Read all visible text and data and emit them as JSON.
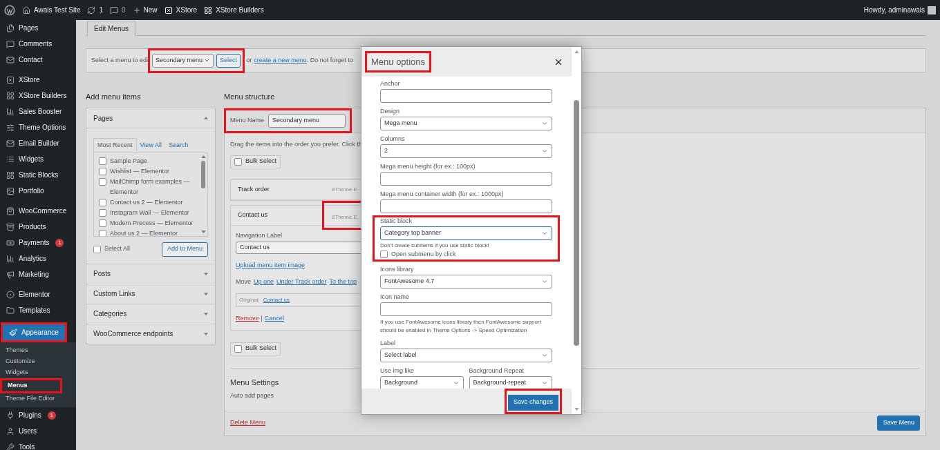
{
  "admin_bar": {
    "site": "Awais Test Site",
    "updates": "1",
    "comments": "0",
    "new": "New",
    "links": [
      "XStore",
      "XStore Builders"
    ],
    "greeting": "Howdy, adminawais"
  },
  "sidebar": {
    "groups": [
      [
        {
          "label": "Pages",
          "selected": false,
          "highlighted": false
        },
        {
          "label": "Comments",
          "selected": false,
          "highlighted": false
        },
        {
          "label": "Contact",
          "selected": false,
          "highlighted": false
        }
      ],
      [
        {
          "label": "XStore",
          "selected": false,
          "highlighted": false
        },
        {
          "label": "XStore Builders",
          "selected": false,
          "highlighted": false
        },
        {
          "label": "Sales Booster",
          "selected": false,
          "highlighted": false
        },
        {
          "label": "Theme Options",
          "selected": false,
          "highlighted": false
        },
        {
          "label": "Email Builder",
          "selected": false,
          "highlighted": false
        },
        {
          "label": "Widgets",
          "selected": false,
          "highlighted": false
        },
        {
          "label": "Static Blocks",
          "selected": false,
          "highlighted": false
        },
        {
          "label": "Portfolio",
          "selected": false,
          "highlighted": false
        }
      ],
      [
        {
          "label": "WooCommerce",
          "selected": false,
          "highlighted": false
        },
        {
          "label": "Products",
          "selected": false,
          "highlighted": false
        },
        {
          "label": "Payments",
          "badge": "1",
          "selected": false,
          "highlighted": false
        },
        {
          "label": "Analytics",
          "selected": false,
          "highlighted": false
        },
        {
          "label": "Marketing",
          "selected": false,
          "highlighted": false
        }
      ],
      [
        {
          "label": "Elementor",
          "selected": false,
          "highlighted": false
        },
        {
          "label": "Templates",
          "selected": false,
          "highlighted": false
        }
      ],
      [
        {
          "label": "Appearance",
          "selected": true,
          "highlighted": true,
          "children": [
            {
              "label": "Themes",
              "selected": false,
              "highlighted": false
            },
            {
              "label": "Customize",
              "selected": false,
              "highlighted": false
            },
            {
              "label": "Widgets",
              "selected": false,
              "highlighted": false
            },
            {
              "label": "Menus",
              "selected": true,
              "highlighted": true
            },
            {
              "label": "Theme File Editor",
              "selected": false,
              "highlighted": false
            }
          ]
        },
        {
          "label": "Plugins",
          "badge": "1",
          "selected": false,
          "highlighted": false
        },
        {
          "label": "Users",
          "selected": false,
          "highlighted": false
        },
        {
          "label": "Tools",
          "selected": false,
          "highlighted": false
        }
      ]
    ]
  },
  "tabs": [
    {
      "label": "Edit Menus",
      "selected": true
    }
  ],
  "menu_select": {
    "label": "Select a menu to edi",
    "value": "Secondary menu",
    "button": "Select",
    "highlighted": true,
    "text_before": "or",
    "link": "create a new menu",
    "text_after": ". Do not forget to"
  },
  "add_items": {
    "title": "Add menu items",
    "sections": [
      {
        "title": "Pages",
        "expanded": true,
        "tabs": [
          {
            "label": "Most Recent",
            "selected": true
          },
          {
            "label": "View All",
            "selected": false
          },
          {
            "label": "Search",
            "selected": false
          }
        ],
        "items": [
          {
            "label": "Sample Page",
            "checked": false
          },
          {
            "label": "Wishlist — Elementor",
            "checked": false
          },
          {
            "label": "MailChimp form examples — Elementor",
            "checked": false
          },
          {
            "label": "Contact us 2 — Elementor",
            "checked": false
          },
          {
            "label": "Instagram Wall — Elementor",
            "checked": false
          },
          {
            "label": "Modern Precess — Elementor",
            "checked": false
          },
          {
            "label": "About us 2 — Elementor",
            "checked": false
          }
        ],
        "select_all": {
          "label": "Select All",
          "checked": false
        },
        "button": "Add to Menu"
      },
      {
        "title": "Posts",
        "expanded": false
      },
      {
        "title": "Custom Links",
        "expanded": false
      },
      {
        "title": "Categories",
        "expanded": false
      },
      {
        "title": "WooCommerce endpoints",
        "expanded": false
      }
    ]
  },
  "structure": {
    "title": "Menu structure",
    "name_label": "Menu Name",
    "name_value": "Secondary menu",
    "name_highlighted": true,
    "hint": "Drag the items into the order you prefer. Click th",
    "bulk_select": {
      "label": "Bulk Select",
      "checked": false
    },
    "items": [
      {
        "title": "Track order",
        "badge": "8Theme E",
        "highlighted": false,
        "expanded": false
      },
      {
        "title": "Contact us",
        "badge": "8Theme E",
        "highlighted": true,
        "expanded": true,
        "nav_label": "Navigation Label",
        "nav_value": "Contact us",
        "upload": "Upload menu item image",
        "move": "Move",
        "move_links": [
          "Up one",
          "Under Track order",
          "To the top"
        ],
        "original_label": "Original:",
        "original_link": "Contact us",
        "remove": "Remove",
        "separator": "|",
        "cancel": "Cancel"
      }
    ],
    "bulk_select_bottom": {
      "label": "Bulk Select",
      "checked": false
    },
    "settings_title": "Menu Settings",
    "settings_text": "Auto add pages",
    "delete": "Delete Menu",
    "save": "Save Menu"
  },
  "modal": {
    "title": "Menu options",
    "title_highlighted": true,
    "fields": [
      {
        "kind": "text",
        "label": "Anchor"
      },
      {
        "kind": "select",
        "label": "Design",
        "value": "Mega menu"
      },
      {
        "kind": "select",
        "label": "Columns",
        "value": "2"
      },
      {
        "kind": "text",
        "label": "Mega menu height (for ex.: 100px)"
      },
      {
        "kind": "text",
        "label": "Mega menu container width (for ex.: 1000px)"
      },
      {
        "kind": "group",
        "highlighted": true,
        "fields": [
          {
            "kind": "select",
            "label": "Static block",
            "value": "Category top banner",
            "focused": true,
            "note": "Don't create subitems if you use static block!"
          },
          {
            "kind": "checkbox",
            "label": "Open submenu by click",
            "checked": false
          }
        ]
      },
      {
        "kind": "select",
        "label": "Icons library",
        "value": "FontAwesome 4.7"
      },
      {
        "kind": "text",
        "label": "Icon name",
        "note": "If you use FontAwesome icons library then FontAwesome support should be enabled in Theme Options -> Speed Optimization"
      },
      {
        "kind": "select",
        "label": "Label",
        "value": "Select label"
      },
      {
        "kind": "pair",
        "fields": [
          {
            "kind": "select",
            "label": "Use img like",
            "value": "Background"
          },
          {
            "kind": "select",
            "label": "Background Repeat",
            "value": "Background-repeat"
          }
        ]
      }
    ],
    "save": "Save changes",
    "save_highlighted": true
  }
}
